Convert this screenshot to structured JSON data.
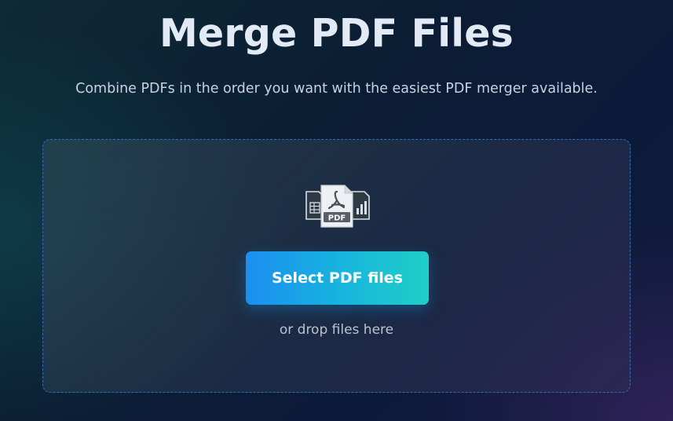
{
  "header": {
    "title": "Merge PDF Files",
    "subtitle": "Combine PDFs in the order you want with the easiest PDF merger available."
  },
  "dropzone": {
    "icon": "pdf-files-icon",
    "icon_badge": "PDF",
    "button_label": "Select PDF files",
    "hint": "or drop files here"
  },
  "colors": {
    "accent_start": "#1a8ff2",
    "accent_end": "#1fcfc7",
    "dropzone_border": "#2f6fb0"
  }
}
